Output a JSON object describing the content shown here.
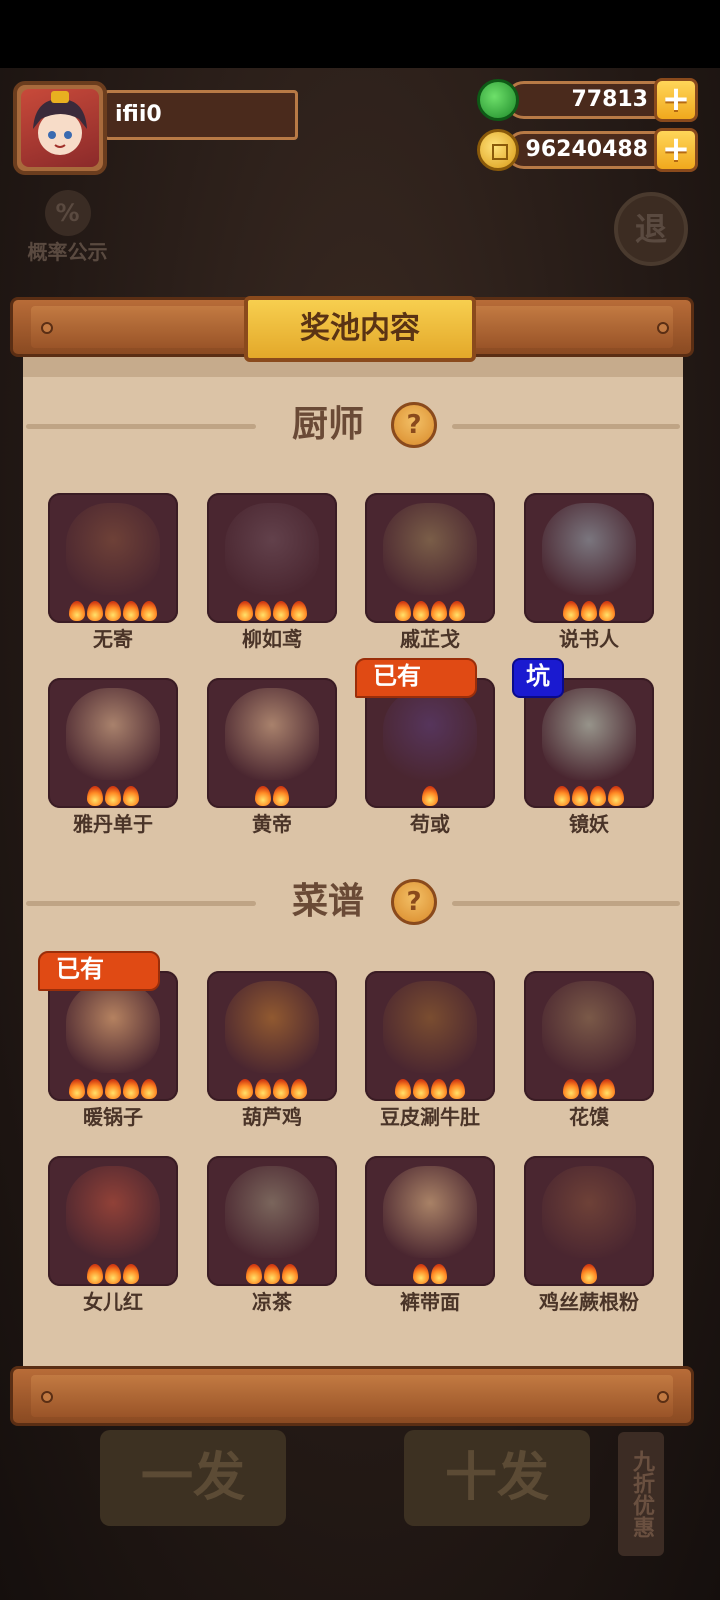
{
  "profile": {
    "name": "ifii0"
  },
  "currency": [
    {
      "label": "jade",
      "value": "77813",
      "color": "#2fb240"
    },
    {
      "label": "coin",
      "value": "96240488",
      "color": "#f1b629"
    }
  ],
  "background": {
    "probability_label": "概率公示",
    "exit_label": "退",
    "single_draw": "一发",
    "ten_draw": "十发",
    "discount": "九折优惠"
  },
  "panel": {
    "title": "奖池内容",
    "sections": [
      {
        "title": "厨师",
        "items": [
          {
            "name": "无寄",
            "flames": 5,
            "badge": ""
          },
          {
            "name": "柳如鸢",
            "flames": 4,
            "badge": ""
          },
          {
            "name": "戚芷戈",
            "flames": 4,
            "badge": ""
          },
          {
            "name": "说书人",
            "flames": 3,
            "badge": ""
          },
          {
            "name": "雅丹单于",
            "flames": 3,
            "badge": ""
          },
          {
            "name": "黄帝",
            "flames": 2,
            "badge": ""
          },
          {
            "name": "苟或",
            "flames": 1,
            "badge": "已有"
          },
          {
            "name": "镜妖",
            "flames": 4,
            "badge": "坑"
          }
        ]
      },
      {
        "title": "菜谱",
        "items": [
          {
            "name": "暖锅子",
            "flames": 5,
            "badge": "已有"
          },
          {
            "name": "葫芦鸡",
            "flames": 4,
            "badge": ""
          },
          {
            "name": "豆皮涮牛肚",
            "flames": 4,
            "badge": ""
          },
          {
            "name": "花馍",
            "flames": 3,
            "badge": ""
          },
          {
            "name": "女儿红",
            "flames": 3,
            "badge": ""
          },
          {
            "name": "凉茶",
            "flames": 3,
            "badge": ""
          },
          {
            "name": "裤带面",
            "flames": 2,
            "badge": ""
          },
          {
            "name": "鸡丝蕨根粉",
            "flames": 1,
            "badge": ""
          }
        ]
      }
    ]
  }
}
